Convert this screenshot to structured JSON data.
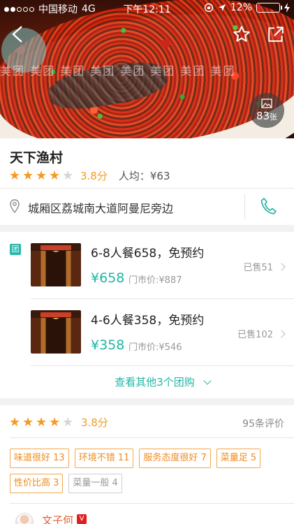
{
  "status_bar": {
    "carrier": "中国移动",
    "network": "4G",
    "time": "下午12:11",
    "battery": "12%",
    "battery_level": 0.12,
    "signal_bars_filled": 2,
    "signal_bars_total": 5
  },
  "hero": {
    "watermark": "美团 美团 美团 美团 美团 美团 美团 美团",
    "photo_count": "83",
    "photo_unit": "张",
    "icons": {
      "back": "back-arrow-icon",
      "favorite": "star-outline-icon",
      "share": "share-icon",
      "photos": "image-icon"
    }
  },
  "shop": {
    "name": "天下渔村",
    "rating": 3.8,
    "score_text": "3.8分",
    "avg_price": "人均：¥63",
    "address": "城厢区荔城南大道阿曼尼旁边",
    "icons": {
      "location": "location-pin-icon",
      "phone": "phone-icon"
    }
  },
  "deals": {
    "badge": "团",
    "items": [
      {
        "title": "6-8人餐658，免预约",
        "price": "¥658",
        "original": "门市价:¥887",
        "sold": "已售51"
      },
      {
        "title": "4-6人餐358，免预约",
        "price": "¥358",
        "original": "门市价:¥546",
        "sold": "已售102"
      }
    ],
    "more": "查看其他3个团购"
  },
  "reviews": {
    "rating": 3.8,
    "score_text": "3.8分",
    "count": "95条评价",
    "tags": [
      {
        "label": "味道很好 13",
        "positive": true
      },
      {
        "label": "环境不错 11",
        "positive": true
      },
      {
        "label": "服务态度很好 7",
        "positive": true
      },
      {
        "label": "菜量足 5",
        "positive": true
      },
      {
        "label": "性价比高 3",
        "positive": true
      },
      {
        "label": "菜量一般 4",
        "positive": false
      }
    ],
    "first_user": {
      "name": "文子何",
      "badge": "V"
    }
  },
  "colors": {
    "accent": "#1fb6a4",
    "star": "#f59a23",
    "tag": "#f08c20"
  }
}
